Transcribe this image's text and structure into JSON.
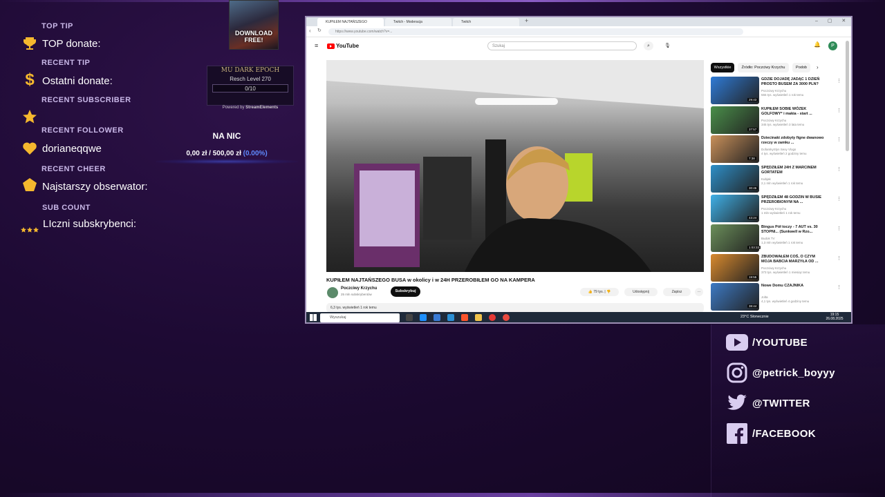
{
  "overlay": {
    "top_tip_label": "TOP TIP",
    "top_tip_value": "TOP donate:",
    "recent_tip_label": "RECENT TIP",
    "recent_tip_value": "Ostatni donate:",
    "recent_subscriber_label": "RECENT SUBSCRIBER",
    "recent_follower_label": "RECENT FOLLOWER",
    "recent_follower_value": "dorianeqqwe",
    "recent_cheer_label": "RECENT CHEER",
    "recent_cheer_value": "Najstarszy obserwator:",
    "sub_count_label": "SUB COUNT",
    "sub_count_value": "LIczni subskrybenci:"
  },
  "game_widget": {
    "thumb_text": "DOWNLOAD FREE!",
    "logo": "MU DARK EPOCH",
    "level_text": "Resch Level 270",
    "progress_text": "0/10",
    "powered_prefix": "Powered by",
    "powered_brand": "StreamElements"
  },
  "goal": {
    "title": "NA NIC",
    "current": "0,00 zł",
    "separator": "/",
    "target": "500,00 zł",
    "percent": "(0.00%)",
    "progress": 0
  },
  "browser": {
    "tabs": [
      "KUPIŁEM NAJTAŃSZEGO",
      "Twitch - Moderacja",
      "Twitch"
    ],
    "url": "https://www.youtube.com/watch?v=...",
    "youtube_logo": "YouTube",
    "search_placeholder": "Szukaj",
    "video_title": "KUPIŁEM NAJTAŃSZEGO BUSA w okolicy i w 24H PRZEROBIŁEM GO NA KAMPERA",
    "channel_name": "Poczciwy Krzychu",
    "channel_subs": "25 mln subskrybentów",
    "subscribe_label": "Subskrybuj",
    "likes_label": "79 tys.",
    "share_label": "Udostępnij",
    "save_label": "Zapisz",
    "description_meta": "6,3 tys. wyświetleń 1 rok temu",
    "chips": [
      "Wszystkie",
      "Źródło: Poczciwy Krzychu",
      "Podob"
    ],
    "suggestions": [
      {
        "title": "GDZIE DOJADĘ JADĄC 1 DZIEŃ PROSTO BUSEM ZA 3000 PLN?",
        "channel": "Poczciwy Krzychu",
        "meta": "555 tys. wyświetleń 1 rok temu",
        "duration": "29:43",
        "thumb": "#2f7bd6"
      },
      {
        "title": "KUPIŁEM SOBIE WÓZEK GOLFOWY* i makia - start ...",
        "channel": "Poczciwy Krzychu",
        "meta": "345 tys. wyświetleń 3 lata temu",
        "duration": "37:57",
        "thumb": "#4a8f4a"
      },
      {
        "title": "Dziecinaki zdobyty figne dwanowo rzeczy w zamku ...",
        "channel": "DofamkySlyn Sexy Vlogs",
        "meta": "4 tys. wyświetleń 2 godziny temu",
        "duration": "7:38",
        "thumb": "#c9905a"
      },
      {
        "title": "SPĘDZIŁEM 24H Z MARCINEM GORTATEM",
        "channel": "Kubjak",
        "meta": "2,1 mln wyświetleń 1 rok temu",
        "duration": "30:46",
        "thumb": "#2e8fc8"
      },
      {
        "title": "SPĘDZIŁEM 48 GODZIN W BUSIE PRZEROBIONYM NA ...",
        "channel": "Poczciwy Krzychu",
        "meta": "1 mln wyświetleń 1 rok temu",
        "duration": "43:24",
        "thumb": "#3fb0e8"
      },
      {
        "title": "Bingus Pół toczy - 7 AUT vs. 30 STOPNI... (Sunkwell w Rzo...",
        "channel": "Budok TV",
        "meta": "1,3 mln wyświetleń 1 rok temu",
        "duration": "1:03:33",
        "thumb": "#6b8f5a"
      },
      {
        "title": "ZBUDOWAŁEM COŚ, O CZYM MOJA BABCIA MARZYŁA OD ...",
        "channel": "Poczciwy Krzychu",
        "meta": "373 tys. wyświetleń 1 miesiąc temu",
        "duration": "19:55",
        "thumb": "#d98a2e"
      },
      {
        "title": "Nowe Domu CZAJNIKA",
        "channel": "Jolta",
        "meta": "4,1 tys. wyświetleń 4 godziny temu",
        "duration": "38:44",
        "thumb": "#3d7ac4"
      }
    ],
    "taskbar_search": "Wyszukaj",
    "weather": "23°C Słonecznie",
    "time": "19:15",
    "date": "26.08.2025"
  },
  "socials": [
    {
      "icon": "youtube-icon",
      "label": "/YOUTUBE"
    },
    {
      "icon": "instagram-icon",
      "label": "@petrick_boyyy"
    },
    {
      "icon": "twitter-icon",
      "label": "@TWITTER"
    },
    {
      "icon": "facebook-icon",
      "label": "/FACEBOOK"
    }
  ],
  "colors": {
    "accent": "#f5b82e",
    "goal_percent": "#5f8bff",
    "youtube_red": "#ff0000"
  }
}
